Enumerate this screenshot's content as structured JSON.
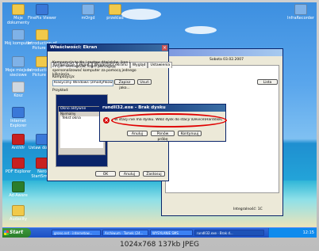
{
  "viewer": {
    "caption": "1024x768 137kb JPEG"
  },
  "desktop_icons": [
    {
      "label": "Moje dokumenty",
      "color": "#f1c94a"
    },
    {
      "label": "Mój komputer",
      "color": "#7fb2e8"
    },
    {
      "label": "Moje miejsca sieciowe",
      "color": "#7fb2e8"
    },
    {
      "label": "Kosz",
      "color": "#d0d8e0"
    },
    {
      "label": "Internet Explorer",
      "color": "#3a78d8"
    },
    {
      "label": "AntiVir",
      "color": "#c82020"
    },
    {
      "label": "PDF Explorer",
      "color": "#c82020"
    },
    {
      "label": "Ad-Aware",
      "color": "#2b7d2b"
    },
    {
      "label": "Audacity",
      "color": "#f1c94a"
    },
    {
      "label": "FinePix Viewer",
      "color": "#3a78d8"
    },
    {
      "label": "Introduction of Picture Re",
      "color": "#f1c94a"
    },
    {
      "label": "Introduction of Picture Fo",
      "color": "#f1c94a"
    },
    {
      "label": "Ustaw dostęp",
      "color": "#3a78d8"
    },
    {
      "label": "Nero StartSmart",
      "color": "#c82020"
    },
    {
      "label": "mOrgd",
      "color": "#7fb2e8"
    },
    {
      "label": "przeklad",
      "color": "#f1c94a"
    },
    {
      "label": "InfraRecorder",
      "color": "#7fb2e8"
    }
  ],
  "display_props": {
    "title": "Właściwości: Ekran",
    "tabs": [
      "Kompozycje",
      "Pulpit",
      "Wygaszacz ekranu",
      "Wygląd",
      "Ustawienia"
    ],
    "description": "Kompozycja to tło i zestaw dźwięków, ikon i innych elementów, które pomagają spersonalizować komputer za pomocą jednego kliknięcia.",
    "composition_label": "Kompozycja:",
    "composition_value": "Klasyczny Windows (zmodyfikowany)",
    "save_as_label": "Zapisz jako...",
    "delete_label": "Usuń",
    "sample_label": "Przykład:",
    "preview_active": "Okno aktywne",
    "preview_normal": "Normalny",
    "preview_text": "Tekst okna",
    "ok_label": "OK",
    "cancel_label": "Anuluj",
    "apply_label": "Zastosuj"
  },
  "back_window": {
    "date_text": "Sobota 03.02.2007",
    "button1": "Lista",
    "bottom_text": "Integralność: 1C"
  },
  "error_dialog": {
    "title": "rundll32.exe - Brak dysku",
    "message": "W stacji nie ma dysku. Włóż dysk do stacji \\Device\\Harddisk2\\DR4.",
    "cancel_label": "Anuluj",
    "retry_label": "Ponów próbę",
    "continue_label": "Kontynuuj",
    "highlight_color": "#e00000"
  },
  "taskbar": {
    "start_label": "Start",
    "tasks": [
      "grono.net - internetow...",
      "Archiwum - Tomek (24...",
      "WYSYŁANIE SMS",
      "rundll32.exe - Brak d..."
    ],
    "clock": "12:15"
  }
}
